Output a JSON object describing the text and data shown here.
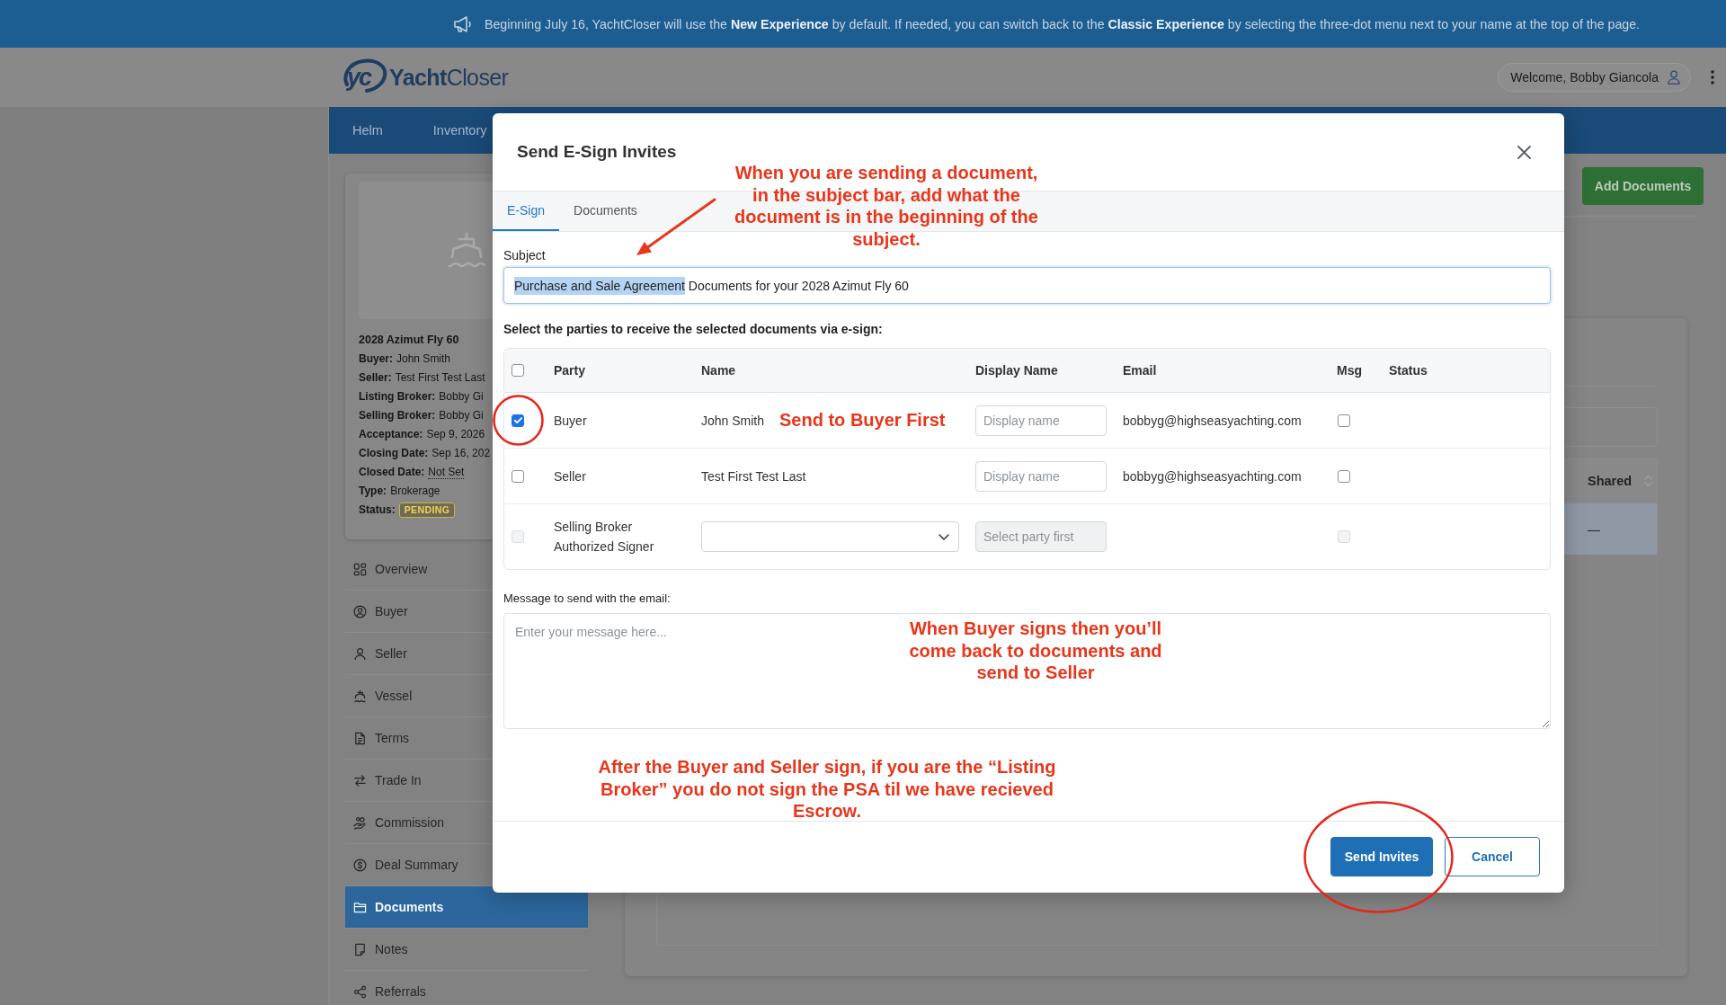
{
  "banner": {
    "text": "Beginning July 16, YachtCloser will use the **New Experience** by default. If needed, you can switch back to the **Classic Experience** by selecting the three-dot menu next to your name at the top of the page."
  },
  "header": {
    "logo_mark": "yc",
    "logo_text": "**Yacht**Closer",
    "welcome": "Welcome, Bobby Giancola"
  },
  "nav": [
    {
      "label": "Helm"
    },
    {
      "label": "Inventory"
    }
  ],
  "deal_card": {
    "title": "2028 Azimut Fly 60",
    "fields": [
      {
        "label": "Buyer:",
        "value": "John Smith",
        "kind": "text"
      },
      {
        "label": "Seller:",
        "value": "Test First Test Last",
        "kind": "text"
      },
      {
        "label": "Listing Broker:",
        "value": "Bobby Gi",
        "kind": "text"
      },
      {
        "label": "Selling Broker:",
        "value": "Bobby Gi",
        "kind": "text"
      },
      {
        "label": "Acceptance:",
        "value": "Sep 9, 2026",
        "kind": "text"
      },
      {
        "label": "Closing Date:",
        "value": "Sep 16, 202",
        "kind": "text"
      },
      {
        "label": "Closed Date:",
        "value": "Not Set",
        "kind": "link"
      },
      {
        "label": "Type:",
        "value": "Brokerage",
        "kind": "text"
      },
      {
        "label": "Status:",
        "value": "PENDING",
        "kind": "badge"
      }
    ]
  },
  "sidebar": [
    {
      "label": "Overview",
      "selected": false
    },
    {
      "label": "Buyer",
      "selected": false
    },
    {
      "label": "Seller",
      "selected": false
    },
    {
      "label": "Vessel",
      "selected": false
    },
    {
      "label": "Terms",
      "selected": false
    },
    {
      "label": "Trade In",
      "selected": false
    },
    {
      "label": "Commission",
      "selected": false
    },
    {
      "label": "Deal Summary",
      "selected": false
    },
    {
      "label": "Documents",
      "selected": true
    },
    {
      "label": "Notes",
      "selected": false
    },
    {
      "label": "Referrals",
      "selected": false
    }
  ],
  "main_panel": {
    "add_button": "Add Documents",
    "table": {
      "columns": [
        "Shared"
      ],
      "rows": [
        {
          "selected": true,
          "cells": [
            "—"
          ]
        }
      ]
    }
  },
  "modal": {
    "title": "Send E-Sign Invites",
    "tabs": [
      {
        "label": "E-Sign",
        "selected": true
      },
      {
        "label": "Documents",
        "selected": false
      }
    ],
    "subject": {
      "label": "Subject",
      "value": [
        {
          "text": "Purchase and Sale Agreement",
          "selected": true
        },
        {
          "text": " Documents for your 2028 Azimut Fly 60",
          "selected": false
        }
      ]
    },
    "parties_prompt": "Select the parties to receive the selected documents via e-sign:",
    "parties": {
      "select_all": {
        "checked": false
      },
      "columns": [
        "Party",
        "Name",
        "Display Name",
        "Email",
        "Msg",
        "Status"
      ],
      "rows": [
        {
          "check": {
            "checked": true,
            "disabled": false
          },
          "party": "Buyer",
          "name": {
            "kind": "text",
            "text": "John Smith"
          },
          "display_name": {
            "placeholder": "Display name",
            "disabled": false
          },
          "email": "bobbyg@highseasyachting.com",
          "msg": {
            "checked": false,
            "disabled": false
          }
        },
        {
          "check": {
            "checked": false,
            "disabled": false
          },
          "party": "Seller",
          "name": {
            "kind": "text",
            "text": "Test First Test Last"
          },
          "display_name": {
            "placeholder": "Display name",
            "disabled": false
          },
          "email": "bobbyg@highseasyachting.com",
          "msg": {
            "checked": false,
            "disabled": false
          }
        },
        {
          "check": {
            "checked": false,
            "disabled": true
          },
          "party": "Selling Broker Authorized Signer",
          "name": {
            "kind": "select"
          },
          "display_name": {
            "placeholder": "Select party first",
            "disabled": true
          },
          "msg": {
            "checked": false,
            "disabled": true
          }
        }
      ]
    },
    "message": {
      "label": "Message to send with the email:",
      "placeholder": "Enter your message here..."
    },
    "buttons": [
      {
        "label": "Send Invites",
        "kind": "primary"
      },
      {
        "label": "Cancel",
        "kind": "secondary"
      }
    ]
  },
  "annotations": [
    {
      "text": "When you are sending a document, in the subject bar, add what the document is in the beginning of the subject."
    },
    {
      "text": "Send to Buyer First"
    },
    {
      "text": "When Buyer signs then you’ll come back to documents and send to Seller"
    },
    {
      "text": "After the Buyer and Seller sign, if you are the “Listing Broker” you do not sign the PSA til we have recieved Escrow."
    }
  ]
}
